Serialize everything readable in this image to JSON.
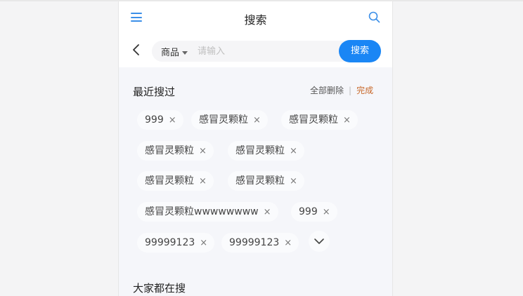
{
  "nav": {
    "title": "搜索",
    "menu_icon": "menu-icon",
    "search_icon": "search-icon"
  },
  "searchbar": {
    "category": "商品",
    "placeholder": "请输入",
    "button_label": "搜索"
  },
  "recent": {
    "title": "最近搜过",
    "delete_all": "全部删除",
    "separator": "|",
    "done": "完成",
    "items": [
      "999",
      "感冒灵颗粒",
      "感冒灵颗粒",
      "感冒灵颗粒",
      "感冒灵颗粒",
      "感冒灵颗粒",
      "感冒灵颗粒",
      "感冒灵颗粒wwwwwwww",
      "999",
      "99999123",
      "99999123"
    ],
    "remove_symbol": "×"
  },
  "hot": {
    "title": "大家都在搜"
  },
  "colors": {
    "accent": "#1a86f5",
    "done": "#c8682a",
    "background": "#f5f6fa"
  }
}
